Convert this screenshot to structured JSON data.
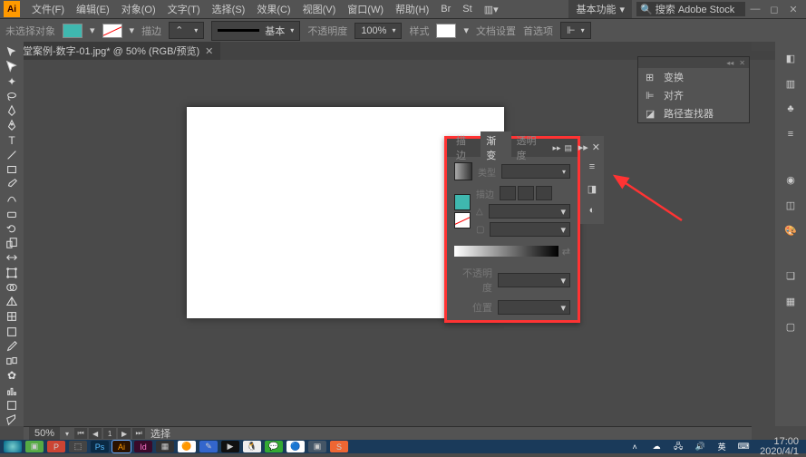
{
  "app": {
    "logo": "Ai"
  },
  "menu": {
    "file": "文件(F)",
    "edit": "编辑(E)",
    "object": "对象(O)",
    "type": "文字(T)",
    "select": "选择(S)",
    "effect": "效果(C)",
    "view": "视图(V)",
    "window": "窗口(W)",
    "help": "帮助(H)",
    "workspace": "基本功能",
    "search_ph": "搜索 Adobe Stock"
  },
  "options": {
    "noselect": "未选择对象",
    "stroke": "描边",
    "basic": "基本",
    "opacity": "不透明度",
    "opacity_val": "100%",
    "style": "样式",
    "docsetup": "文档设置",
    "prefs": "首选项"
  },
  "doc": {
    "tab": "课堂案例-数字-01.jpg* @ 50% (RGB/预览)"
  },
  "rpanel": {
    "transform": "变换",
    "align": "对齐",
    "pathfinder": "路径查找器"
  },
  "gradient": {
    "tab_stroke": "描边",
    "tab_gradient": "渐变",
    "tab_opacity": "透明度",
    "type": "类型",
    "stroke_lbl": "描边",
    "angle": "△",
    "ratio_icon": "▢",
    "opacity": "不透明度",
    "position": "位置"
  },
  "status": {
    "zoom": "50%",
    "page": "1",
    "select": "选择"
  },
  "taskbar": {
    "time": "17:00",
    "date": "2020/4/1",
    "ime": "英"
  }
}
